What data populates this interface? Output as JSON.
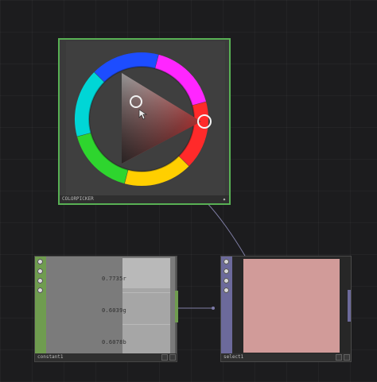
{
  "nodes": {
    "picker": {
      "name": "COLORPICKER",
      "corner_icon": "plus-icon",
      "border_color": "#58b054"
    },
    "constant": {
      "name": "constant1",
      "values": {
        "r": "0.7735r",
        "g": "0.6039g",
        "b": "0.6078b"
      },
      "accent_color": "#6f9c4f"
    },
    "select": {
      "name": "select1",
      "preview_color": "#d19b99",
      "accent_color": "#6c6a9b"
    }
  }
}
